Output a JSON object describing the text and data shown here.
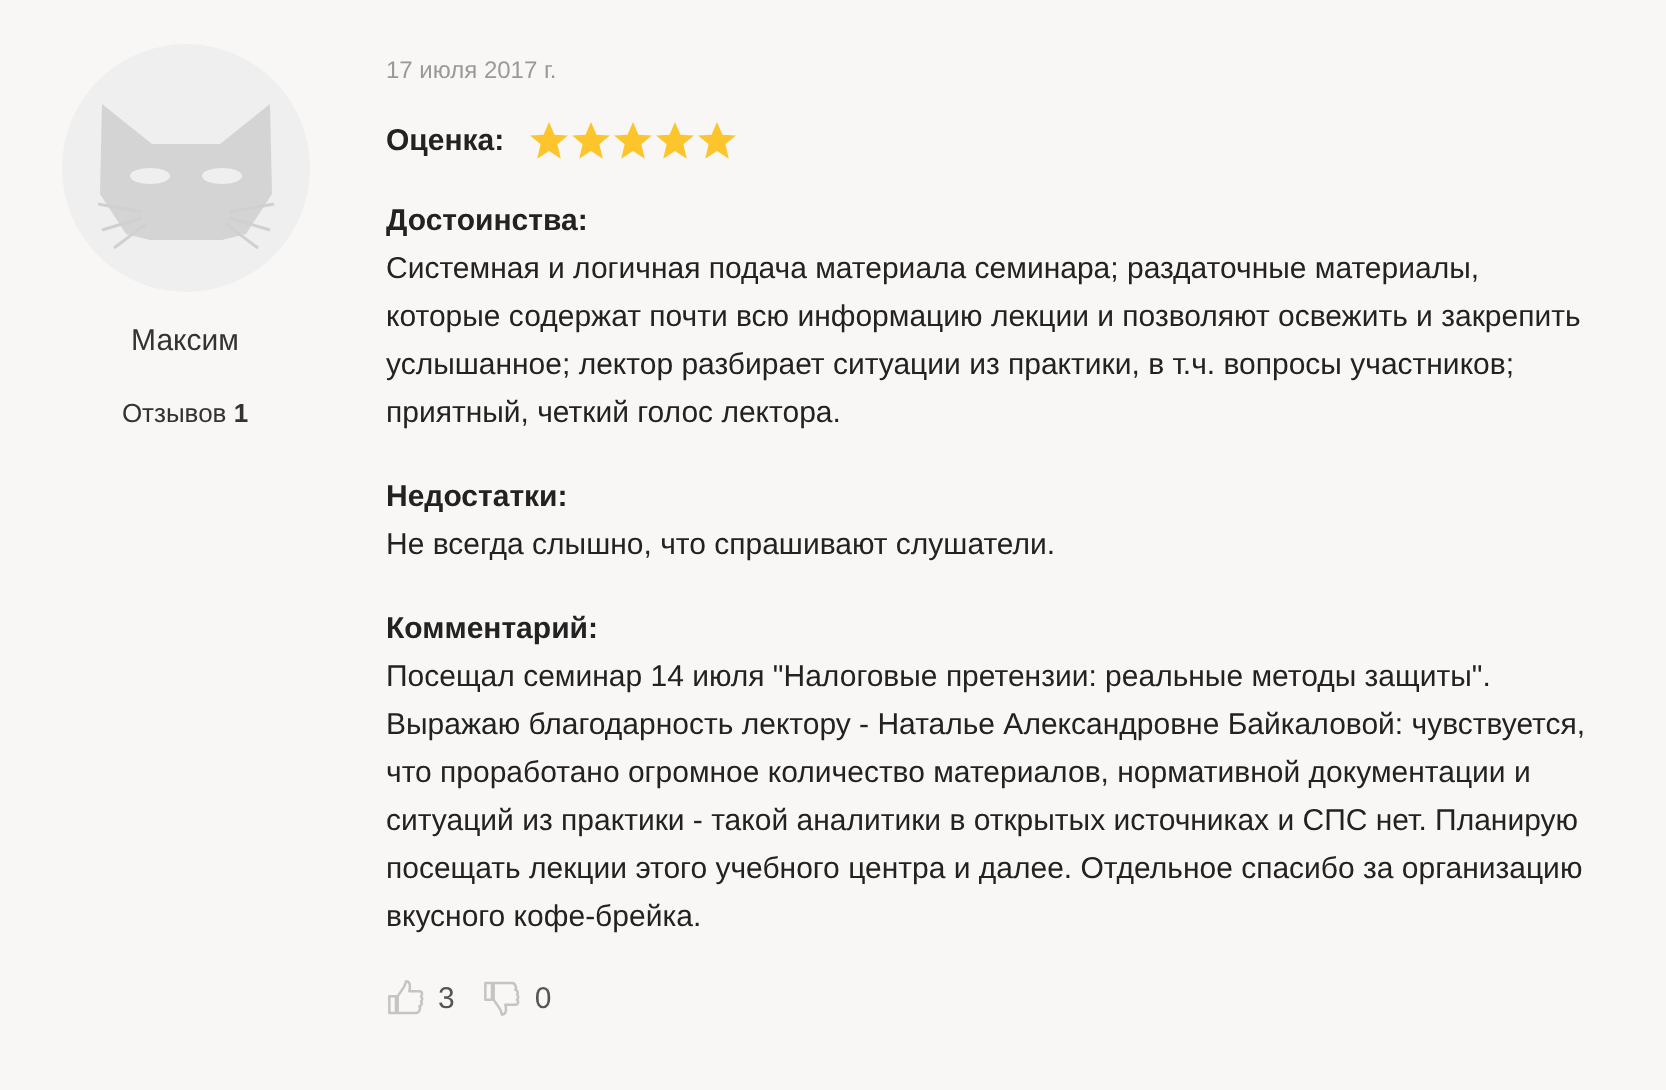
{
  "author": {
    "name": "Максим",
    "reviews_label": "Отзывов",
    "reviews_count": "1"
  },
  "review": {
    "date": "17 июля 2017 г.",
    "rating_label": "Оценка:",
    "stars": 5,
    "sections": [
      {
        "heading": "Достоинства:",
        "text": "Системная и логичная подача материала семинара; раздаточные материалы, которые содержат почти всю информацию лекции и позволяют освежить и закрепить услышанное; лектор разбирает ситуации из практики, в т.ч. вопросы участников; приятный, четкий голос лектора."
      },
      {
        "heading": "Недостатки:",
        "text": "Не всегда слышно, что спрашивают слушатели."
      },
      {
        "heading": "Комментарий:",
        "text": "Посещал семинар 14 июля \"Налоговые претензии: реальные методы защиты\". Выражаю благодарность лектору - Наталье Александровне Байкаловой: чувствуется, что проработано огромное количество материалов, нормативной документации и ситуаций из практики - такой аналитики в открытых источниках и СПС нет. Планирую посещать лекции этого учебного центра и далее. Отдельное спасибо за организацию вкусного кофе-брейка."
      }
    ],
    "likes": "3",
    "dislikes": "0"
  }
}
